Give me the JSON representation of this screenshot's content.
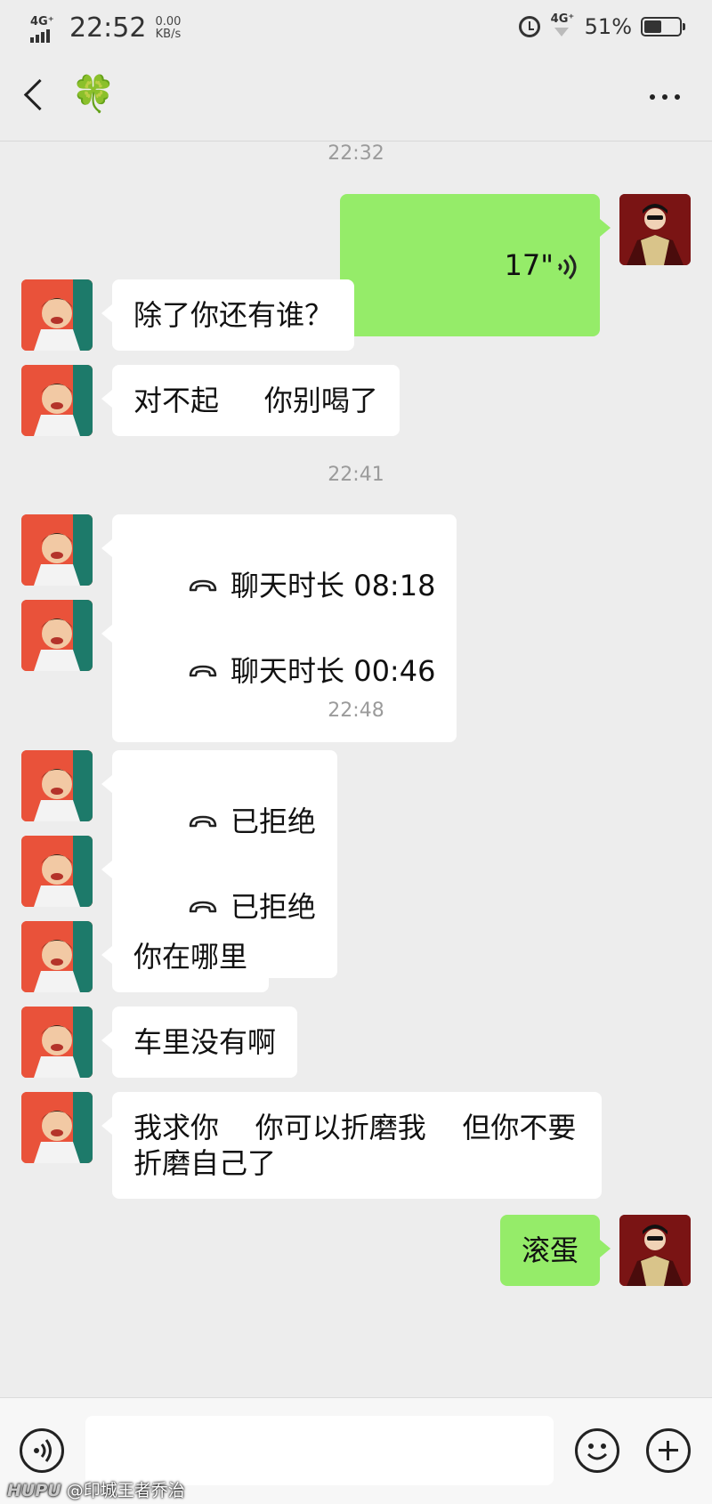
{
  "status_bar": {
    "network_left": "4G⁺",
    "time": "22:52",
    "net_speed_value": "0.00",
    "net_speed_unit": "KB/s",
    "network_right": "4G⁺",
    "battery_percent": "51%",
    "battery_level": 0.51
  },
  "header": {
    "title": "🍀",
    "icons": [
      "back-icon",
      "more-icon"
    ]
  },
  "chat": {
    "timestamps": [
      "22:32",
      "22:41",
      "22:48"
    ],
    "messages": [
      {
        "side": "right",
        "type": "voice",
        "text": "17\"",
        "icon": "voice-wave-icon"
      },
      {
        "side": "left",
        "type": "text",
        "text": "除了你还有谁？"
      },
      {
        "side": "left",
        "type": "text",
        "text": "对不起     你别喝了"
      },
      {
        "side": "left",
        "type": "call",
        "text": "聊天时长 08:18",
        "icon": "phone-hangup-icon"
      },
      {
        "side": "left",
        "type": "call",
        "text": "聊天时长 00:46",
        "icon": "phone-hangup-icon"
      },
      {
        "side": "left",
        "type": "call",
        "text": "已拒绝",
        "icon": "phone-hangup-icon"
      },
      {
        "side": "left",
        "type": "call",
        "text": "已拒绝",
        "icon": "phone-hangup-icon"
      },
      {
        "side": "left",
        "type": "text",
        "text": "你在哪里"
      },
      {
        "side": "left",
        "type": "text",
        "text": "车里没有啊"
      },
      {
        "side": "left",
        "type": "text",
        "text": "我求你    你可以折磨我    但你不要\n折磨自己了"
      },
      {
        "side": "right",
        "type": "text",
        "text": "滚蛋"
      }
    ]
  },
  "input_bar": {
    "input_value": "",
    "icons": [
      "voice-input-icon",
      "emoji-icon",
      "plus-icon"
    ]
  },
  "watermark": {
    "brand": "HUPU",
    "handle": "@印城王者乔治"
  },
  "colors": {
    "background": "#ededed",
    "sent_bubble": "#95ec69",
    "received_bubble": "#ffffff",
    "timestamp_text": "#9b9b9b"
  }
}
